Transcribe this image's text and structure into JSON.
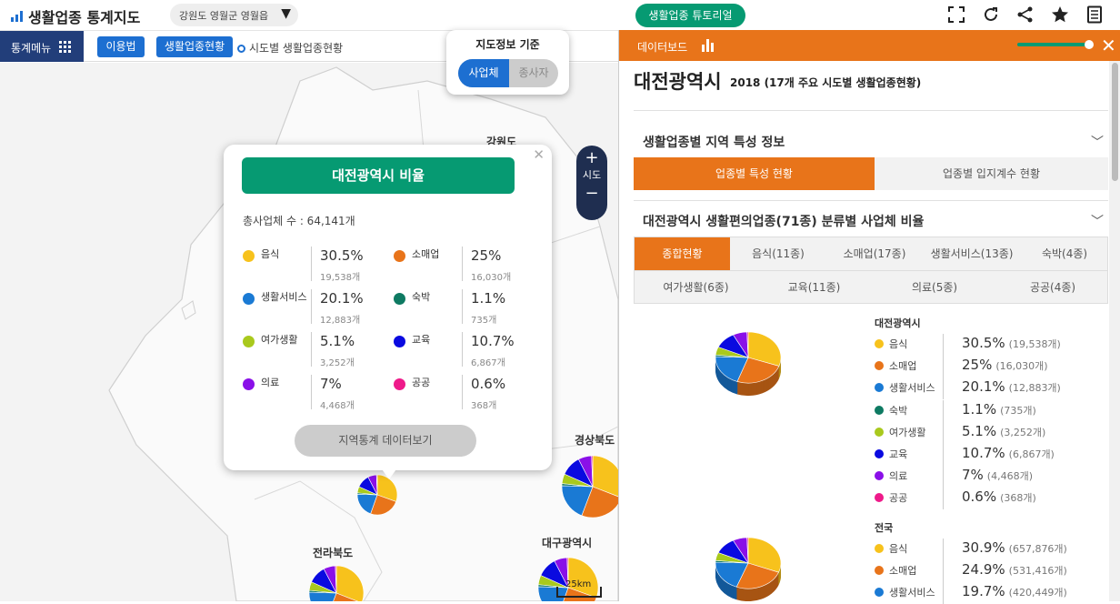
{
  "app": {
    "title": "생활업종 통계지도",
    "region": "강원도 영월군 영월읍",
    "tutorial_label": "생활업종 튜토리얼"
  },
  "colors": {
    "음식": "#f7c21c",
    "소매업": "#e8741a",
    "생활서비스": "#1a7ad4",
    "숙박": "#0e7a62",
    "여가생활": "#a9c91d",
    "교육": "#0a0ae0",
    "의료": "#8a10e8",
    "공공": "#ee1a8a",
    "accent_orange": "#e8741a",
    "accent_green": "#069a72",
    "accent_blue": "#1d6fd1",
    "menu_navy": "#223e7a"
  },
  "toolbar": {
    "icons": [
      "fullscreen-icon",
      "refresh-icon",
      "share-icon",
      "star-icon",
      "document-icon"
    ]
  },
  "subbar": {
    "menu_label": "통계메뉴",
    "usage_label": "이용법",
    "status_label": "생활업종현황",
    "crumb": "시도별 생활업종현황"
  },
  "mapinfo": {
    "title": "지도정보 기준",
    "opt_business": "사업체",
    "opt_worker": "종사자"
  },
  "zoom": {
    "label": "시도"
  },
  "map_labels": {
    "gangwon": "강원도",
    "gyeongbuk": "경상북도",
    "jeonbuk": "전라북도",
    "daegu": "대구광역시",
    "scale": "25km"
  },
  "popup": {
    "title": "대전광역시 비율",
    "total": "총사업체 수 : 64,141개",
    "items": [
      {
        "name": "음식",
        "pct": "30.5%",
        "count": "19,538개"
      },
      {
        "name": "소매업",
        "pct": "25%",
        "count": "16,030개"
      },
      {
        "name": "생활서비스",
        "pct": "20.1%",
        "count": "12,883개"
      },
      {
        "name": "숙박",
        "pct": "1.1%",
        "count": "735개"
      },
      {
        "name": "여가생활",
        "pct": "5.1%",
        "count": "3,252개"
      },
      {
        "name": "교육",
        "pct": "10.7%",
        "count": "6,867개"
      },
      {
        "name": "의료",
        "pct": "7%",
        "count": "4,468개"
      },
      {
        "name": "공공",
        "pct": "0.6%",
        "count": "368개"
      }
    ],
    "button": "지역통계 데이터보기"
  },
  "panel": {
    "header": "데이터보드",
    "city": "대전광역시",
    "subtitle": "2018 (17개 주요 시도별 생활업종현황)",
    "section1": "생활업종별 지역 특성 정보",
    "tab_a": "업종별 특성 현황",
    "tab_b": "업종별 입지계수 현황",
    "section2": "대전광역시 생활편의업종(71종) 분류별 사업체 비율",
    "subtabs": [
      "종합현황",
      "음식(11종)",
      "소매업(17종)",
      "생활서비스(13종)",
      "숙박(4종)",
      "여가생활(6종)",
      "교육(11종)",
      "의료(5종)",
      "공공(4종)"
    ],
    "group1": {
      "name": "대전광역시",
      "rows": [
        {
          "name": "음식",
          "pct": "30.5%",
          "count": "(19,538개)"
        },
        {
          "name": "소매업",
          "pct": "25%",
          "count": "(16,030개)"
        },
        {
          "name": "생활서비스",
          "pct": "20.1%",
          "count": "(12,883개)"
        },
        {
          "name": "숙박",
          "pct": "1.1%",
          "count": "(735개)"
        },
        {
          "name": "여가생활",
          "pct": "5.1%",
          "count": "(3,252개)"
        },
        {
          "name": "교육",
          "pct": "10.7%",
          "count": "(6,867개)"
        },
        {
          "name": "의료",
          "pct": "7%",
          "count": "(4,468개)"
        },
        {
          "name": "공공",
          "pct": "0.6%",
          "count": "(368개)"
        }
      ]
    },
    "group2": {
      "name": "전국",
      "rows": [
        {
          "name": "음식",
          "pct": "30.9%",
          "count": "(657,876개)"
        },
        {
          "name": "소매업",
          "pct": "24.9%",
          "count": "(531,416개)"
        },
        {
          "name": "생활서비스",
          "pct": "19.7%",
          "count": "(420,449개)"
        }
      ]
    }
  },
  "pie_values": {
    "daejeon": [
      30.5,
      25,
      20.1,
      1.1,
      5.1,
      10.7,
      7,
      0.6
    ],
    "nation": [
      30.9,
      24.9,
      19.7,
      1.1,
      5.1,
      10.7,
      7,
      0.6
    ]
  }
}
